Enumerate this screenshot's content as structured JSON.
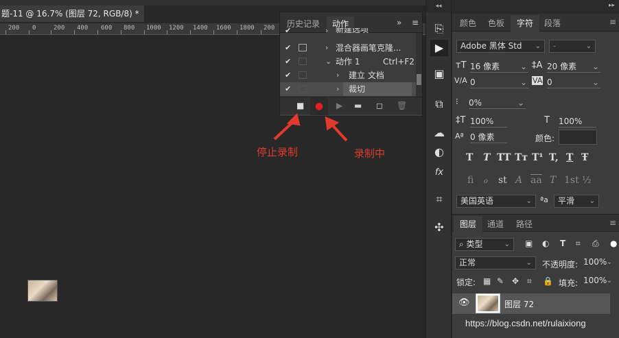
{
  "document": {
    "tab_title": "题-11 @ 16.7% (图层 72, RGB/8) *",
    "close": "×"
  },
  "ruler": {
    "labels": [
      "200",
      "0",
      "200",
      "400",
      "600",
      "800",
      "1000",
      "1200",
      "1400",
      "1600",
      "1800",
      "200"
    ]
  },
  "annotations": {
    "stop": "停止录制",
    "recording": "录制中"
  },
  "actions_panel": {
    "tabs": [
      "历史记录",
      "动作"
    ],
    "collapse": "»",
    "menu": "≡",
    "rows": [
      {
        "label": "新建选项",
        "check": "✔",
        "expand": "›"
      },
      {
        "label": "混合器画笔克隆...",
        "check": "✔",
        "expand": "›"
      },
      {
        "label": "动作 1",
        "shortcut": "Ctrl+F2",
        "check": "✔",
        "expand": "⌄"
      },
      {
        "label": "建立 文档",
        "check": "✔",
        "expand": "›"
      },
      {
        "label": "裁切",
        "check": "✔",
        "expand": "›"
      }
    ],
    "toolbar": [
      "stop-icon",
      "record-icon",
      "play-icon",
      "folder-icon",
      "new-icon",
      "trash-icon"
    ]
  },
  "char_panel": {
    "tabs": [
      "颜色",
      "色板",
      "字符",
      "段落"
    ],
    "font_family": "Adobe 黑体 Std",
    "font_style": "-",
    "font_size": "16 像素",
    "leading": "20 像素",
    "kerning": "0",
    "tracking": "0",
    "scale_percent": "0%",
    "vscale": "100%",
    "hscale": "100%",
    "baseline": "0 像素",
    "color_label": "颜色:",
    "color": "#2a2a2a",
    "style_buttons": [
      "T",
      "T",
      "TT",
      "Tт",
      "T¹",
      "T,",
      "T",
      "Ŧ"
    ],
    "opentype_buttons": [
      "fi",
      "ℴ",
      "st",
      "A",
      "aa",
      "T",
      "1st",
      "½"
    ],
    "language": "美国英语",
    "aa_icon": "ªa",
    "antialias": "平滑"
  },
  "layers_panel": {
    "tabs": [
      "图层",
      "通道",
      "路径"
    ],
    "filter": "类型",
    "blend_mode": "正常",
    "opacity_label": "不透明度:",
    "opacity": "100%",
    "lock_label": "锁定:",
    "fill_label": "填充:",
    "fill": "100%",
    "layer_name": "图层 72"
  },
  "top_collapse": "◂◂",
  "right_collapse": "▸▸",
  "watermark": "https://blog.csdn.net/rulaixiong"
}
